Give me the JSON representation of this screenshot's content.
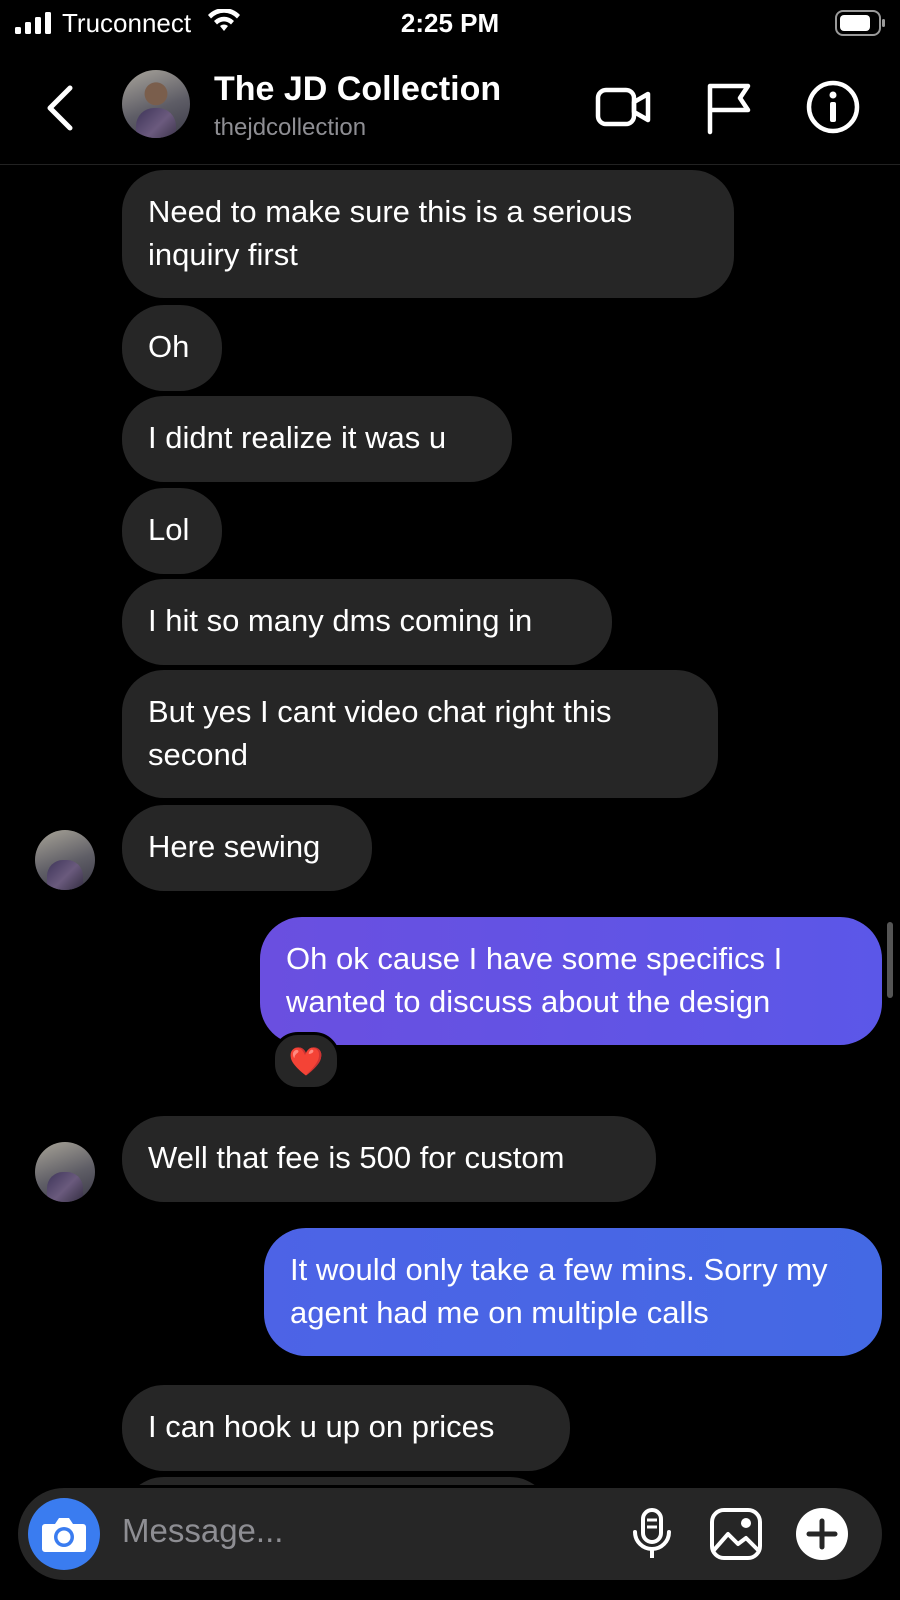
{
  "status_bar": {
    "carrier": "Truconnect",
    "time": "2:25 PM"
  },
  "header": {
    "title": "The JD Collection",
    "username": "thejdcollection",
    "icons": [
      "back-chevron-icon",
      "video-call-icon",
      "flag-icon",
      "info-icon"
    ]
  },
  "messages": [
    {
      "from": "them",
      "text": "Need to make sure this is a serious inquiry first"
    },
    {
      "from": "them",
      "text": "Oh"
    },
    {
      "from": "them",
      "text": "I didnt realize it was u"
    },
    {
      "from": "them",
      "text": "Lol"
    },
    {
      "from": "them",
      "text": "I hit so many dms coming in"
    },
    {
      "from": "them",
      "text": "But yes I cant video chat right this second"
    },
    {
      "from": "them",
      "text": "Here sewing"
    },
    {
      "from": "me",
      "text": "Oh ok cause I have some specifics I wanted to discuss about the design",
      "reaction": "❤️"
    },
    {
      "from": "them",
      "text": "Well that fee is 500 for custom"
    },
    {
      "from": "me",
      "text": "It would only take a few mins. Sorry my agent had me on multiple calls"
    },
    {
      "from": "them",
      "text": "I can hook u up on prices"
    }
  ],
  "composer": {
    "placeholder": "Message...",
    "icons": [
      "camera-icon",
      "microphone-icon",
      "gallery-icon",
      "add-icon"
    ]
  },
  "colors": {
    "background": "#000000",
    "received_bubble": "#262626",
    "sent_bubble_purple": "#5f53e4",
    "sent_bubble_blue": "#4767e5",
    "camera_button": "#3a7cf0"
  }
}
